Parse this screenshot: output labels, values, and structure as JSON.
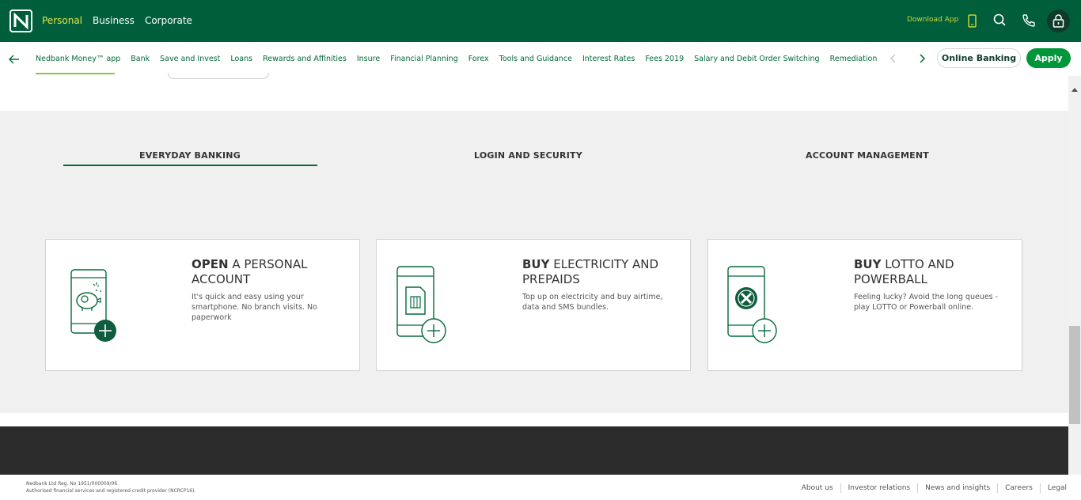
{
  "topbar": {
    "logo": "nedbank-logo",
    "segments": [
      "Personal",
      "Business",
      "Corporate"
    ],
    "active_segment": "Personal",
    "download_app": "Download App",
    "icons": [
      "mobile-phone-icon",
      "search-icon",
      "phone-icon",
      "lock-icon"
    ]
  },
  "subnav": {
    "items": [
      "Nedbank Money™ app",
      "Bank",
      "Save and Invest",
      "Loans",
      "Rewards and Affinities",
      "Insure",
      "Financial Planning",
      "Forex",
      "Tools and Guidance",
      "Interest Rates",
      "Fees 2019",
      "Salary and Debit Order Switching",
      "Remediation"
    ],
    "active_item": "Nedbank Money™ app",
    "online_banking": "Online Banking",
    "apply": "Apply"
  },
  "tabs": [
    {
      "label": "EVERYDAY BANKING",
      "active": true
    },
    {
      "label": "LOGIN AND SECURITY",
      "active": false
    },
    {
      "label": "ACCOUNT MANAGEMENT",
      "active": false
    }
  ],
  "cards": [
    {
      "bold": "OPEN",
      "rest": " A PERSONAL ACCOUNT",
      "desc": "It's quick and easy using your smartphone. No branch visits. No paperwork",
      "icon": "piggy-bank-phone-icon"
    },
    {
      "bold": "BUY",
      "rest": " ELECTRICITY AND PREPAIDS",
      "desc": "Top up on electricity and buy airtime, data and SMS bundles.",
      "icon": "sim-card-phone-icon"
    },
    {
      "bold": "BUY",
      "rest": " LOTTO AND POWERBALL",
      "desc": "Feeling lucky? Avoid the long queues - play LOTTO or Powerball online.",
      "icon": "lotto-phone-icon"
    }
  ],
  "footer": {
    "legal_line1": "Nedbank Ltd Reg. No 1951/000009/06.",
    "legal_line2": "Authorised financial services and registered credit provider (NCRCP16).",
    "links": [
      "About us",
      "Investor relations",
      "News and insights",
      "Careers",
      "Legal"
    ]
  },
  "colors": {
    "brand_green": "#005e3b",
    "accent_green": "#009639",
    "highlight_yellow": "#e4e54a"
  }
}
